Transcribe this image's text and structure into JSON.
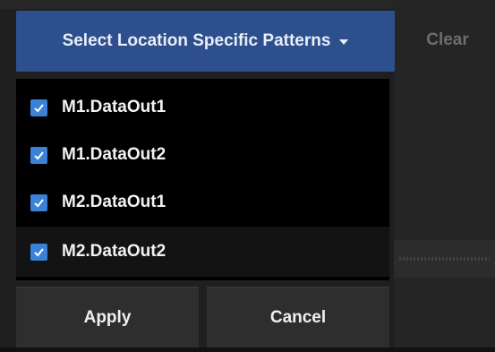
{
  "toolbar": {
    "select_label": "Select Location Specific Patterns",
    "clear_label": "Clear"
  },
  "dropdown": {
    "options": [
      {
        "label": "M1.DataOut1",
        "checked": true
      },
      {
        "label": "M1.DataOut2",
        "checked": true
      },
      {
        "label": "M2.DataOut1",
        "checked": true
      },
      {
        "label": "M2.DataOut2",
        "checked": true
      }
    ],
    "apply_label": "Apply",
    "cancel_label": "Cancel"
  },
  "colors": {
    "primary_button": "#2d4f8e",
    "checkbox": "#3a82d6",
    "menu_background": "#000000",
    "footer_button": "#2e2e2e"
  },
  "icons": {
    "caret": "caret-down-icon",
    "checkbox": "checkmark-icon"
  }
}
